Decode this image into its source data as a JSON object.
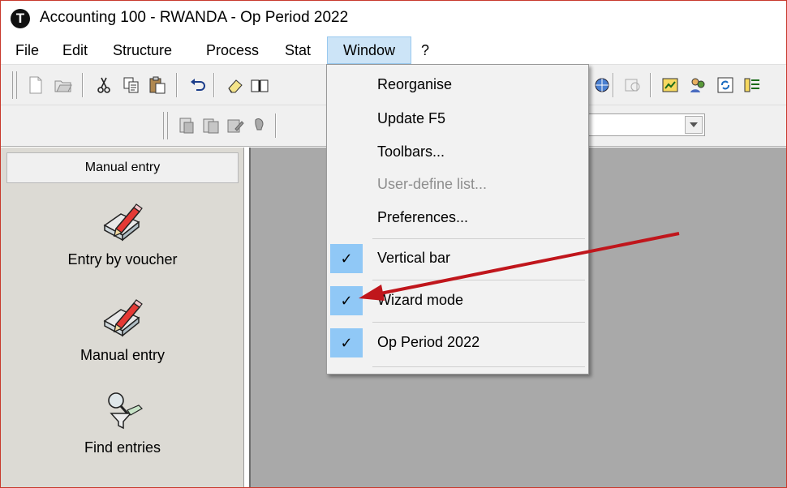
{
  "window": {
    "title": "Accounting 100 - RWANDA - Op Period 2022",
    "logo_glyph": "T",
    "logo_icon": "app-logo-icon"
  },
  "menubar": {
    "items": [
      "File",
      "Edit",
      "Structure",
      "Process",
      "Stat",
      "Window",
      "?"
    ],
    "active": "Window"
  },
  "toolbar1": {
    "icons": [
      "new-document-icon",
      "open-folder-icon",
      "cut-icon",
      "copy-icon",
      "paste-icon",
      "undo-icon",
      "eraser-icon",
      "book-icon"
    ],
    "right_icons": [
      "globe-icon",
      "disabled-icon",
      "chart-icon",
      "people-icon",
      "refresh-icon",
      "grid-icon"
    ]
  },
  "toolbar2": {
    "icons": [
      "document-icon",
      "document-stack-icon",
      "document-edit-icon",
      "pin-icon"
    ],
    "combo_value": ""
  },
  "window_menu": {
    "items": [
      {
        "label": "Reorganise",
        "enabled": true,
        "checked": false
      },
      {
        "label": "Update F5",
        "enabled": true,
        "checked": false
      },
      {
        "label": "Toolbars...",
        "enabled": true,
        "checked": false
      },
      {
        "label": "User-define list...",
        "enabled": false,
        "checked": false
      },
      {
        "label": "Preferences...",
        "enabled": true,
        "checked": false
      },
      {
        "label": "Vertical bar",
        "enabled": true,
        "checked": true
      },
      {
        "label": "Wizard mode",
        "enabled": true,
        "checked": true
      },
      {
        "label": "Op Period 2022",
        "enabled": true,
        "checked": true
      }
    ],
    "check_glyph": "✓"
  },
  "left_panel": {
    "header": "Manual entry",
    "entries": [
      {
        "label": "Entry by voucher",
        "icon": "pencil-book-icon"
      },
      {
        "label": "Manual entry",
        "icon": "pencil-book-icon"
      },
      {
        "label": "Find entries",
        "icon": "magnifier-funnel-icon"
      }
    ]
  },
  "colors": {
    "menu_highlight": "#cce4f7",
    "check_background": "#90c8f6",
    "panel_background": "#dcdad4",
    "workspace_background": "#a9a9a9",
    "annotation_arrow": "#c0161c"
  }
}
